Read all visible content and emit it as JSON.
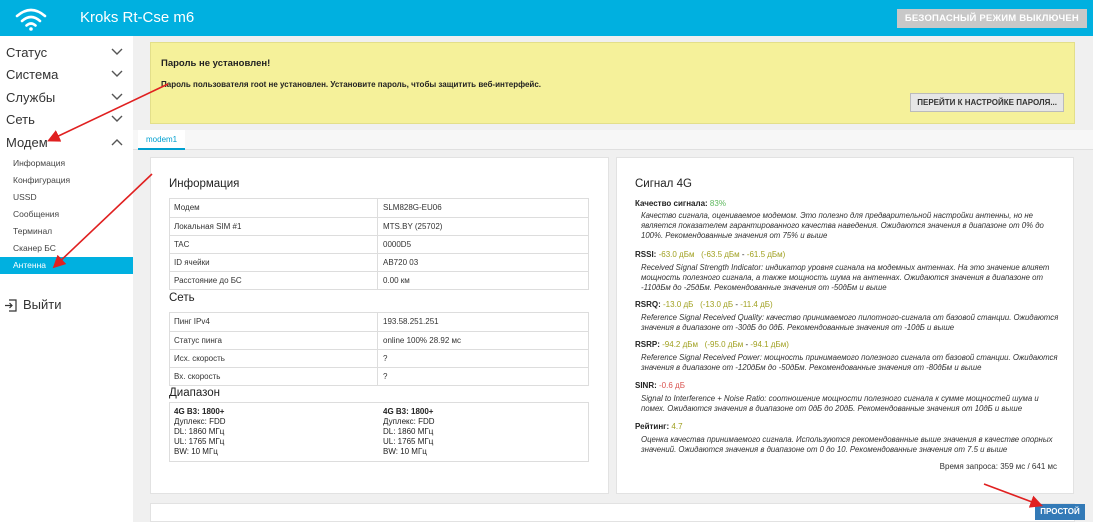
{
  "header": {
    "title": "Kroks Rt-Cse m6",
    "safe_mode_label": "БЕЗОПАСНЫЙ РЕЖИМ ВЫКЛЮЧЕН"
  },
  "sidebar": {
    "items": [
      {
        "label": "Статус"
      },
      {
        "label": "Система"
      },
      {
        "label": "Службы"
      },
      {
        "label": "Сеть"
      },
      {
        "label": "Модем"
      }
    ],
    "modem_sub": [
      {
        "label": "Информация"
      },
      {
        "label": "Конфигурация"
      },
      {
        "label": "USSD"
      },
      {
        "label": "Сообщения"
      },
      {
        "label": "Терминал"
      },
      {
        "label": "Сканер БС"
      },
      {
        "label": "Антенна"
      }
    ],
    "logout_label": "Выйти"
  },
  "warning": {
    "title": "Пароль не установлен!",
    "text": "Пароль пользователя root не установлен. Установите пароль, чтобы защитить веб-интерфейс.",
    "button": "ПЕРЕЙТИ К НАСТРОЙКЕ ПАРОЛЯ..."
  },
  "tabs": [
    {
      "label": "modem1"
    }
  ],
  "info": {
    "title": "Информация",
    "rows": [
      {
        "key": "Модем",
        "value": "SLM828G-EU06"
      },
      {
        "key": "Локальная SIM #1",
        "value": "MTS.BY (25702)"
      },
      {
        "key": "TAC",
        "value": "0000D5"
      },
      {
        "key": "ID ячейки",
        "value": "AB720    03"
      },
      {
        "key": "Расстояние до БС",
        "value": "0.00 км"
      }
    ]
  },
  "network": {
    "title": "Сеть",
    "rows": [
      {
        "key": "Пинг IPv4",
        "value": "193.58.251.251"
      },
      {
        "key": "Статус пинга",
        "value": "online 100% 28.92 мс"
      },
      {
        "key": "Исх. скорость",
        "value": "?"
      },
      {
        "key": "Вх. скорость",
        "value": "?"
      }
    ]
  },
  "range": {
    "title": "Диапазон",
    "bands": [
      {
        "title": "4G B3: 1800+",
        "duplex": "Дуплекс: FDD",
        "dl": "DL: 1860 МГц",
        "ul": "UL: 1765 МГц",
        "bw": "BW: 10 МГц"
      },
      {
        "title": "4G B3: 1800+",
        "duplex": "Дуплекс: FDD",
        "dl": "DL: 1860 МГц",
        "ul": "UL: 1765 МГц",
        "bw": "BW: 10 МГц"
      }
    ]
  },
  "signal": {
    "title": "Сигнал 4G",
    "quality": {
      "label": "Качество сигнала:",
      "value": "83%",
      "desc": "Качество сигнала, оцениваемое модемом. Это полезно для предварительной настройки антенны, но не является показателем гарантированного качества наведения. Ожидаются значения в диапазоне от 0% до 100%. Рекомендованные значения от 75% и выше"
    },
    "rssi": {
      "label": "RSSI:",
      "value": "-63.0 дБм",
      "range_open": "(-63.5 дБм",
      "range_sep": " - ",
      "range_close": "-61.5 дБм)",
      "desc": "Received Signal Strength Indicator: индикатор уровня сигнала на модемных антеннах. На это значение влияет мощность полезного сигнала, а также мощность шума на антеннах. Ожидаются значения в диапазоне от -110дБм до -25дБм. Рекомендованные значения от -50дБм и выше"
    },
    "rsrq": {
      "label": "RSRQ:",
      "value": "-13.0 дБ",
      "range_open": "(-13.0 дБ",
      "range_sep": " - ",
      "range_close": "-11.4 дБ)",
      "desc": "Reference Signal Received Quality: качество принимаемого пилотного-сигнала от базовой станции. Ожидаются значения в диапазоне от -30дБ до 0дБ. Рекомендованные значения от -10дБ и выше"
    },
    "rsrp": {
      "label": "RSRP:",
      "value": "-94.2 дБм",
      "range_open": "(-95.0 дБм",
      "range_sep": " - ",
      "range_close": "-94.1 дБм)",
      "desc": "Reference Signal Received Power: мощность принимаемого полезного сигнала от базовой станции. Ожидаются значения в диапазоне от -120дБм до -50дБм. Рекомендованные значения от -80дБм и выше"
    },
    "sinr": {
      "label": "SINR:",
      "value": "-0.6 дБ",
      "desc": "Signal to Interference + Noise Ratio: соотношение мощности полезного сигнала к сумме мощностей шума и помех. Ожидаются значения в диапазоне от 0дБ до 20дБ. Рекомендованные значения от 10дБ и выше"
    },
    "rating": {
      "label": "Рейтинг:",
      "value": "4.7",
      "desc": "Оценка качества принимаемого сигнала. Используются рекомендованные выше значения в качестве опорных значений. Ожидаются значения в диапазоне от 0 до 10. Рекомендованные значения от 7.5 и выше"
    },
    "request_time": "Время запроса: 359 мс / 641 мс"
  },
  "footer": {
    "simple_button": "ПРОСТОЙ"
  },
  "colors": {
    "accent": "#00b0e0",
    "warning_bg": "#f5f19a",
    "annotation_arrow": "#e02020"
  }
}
